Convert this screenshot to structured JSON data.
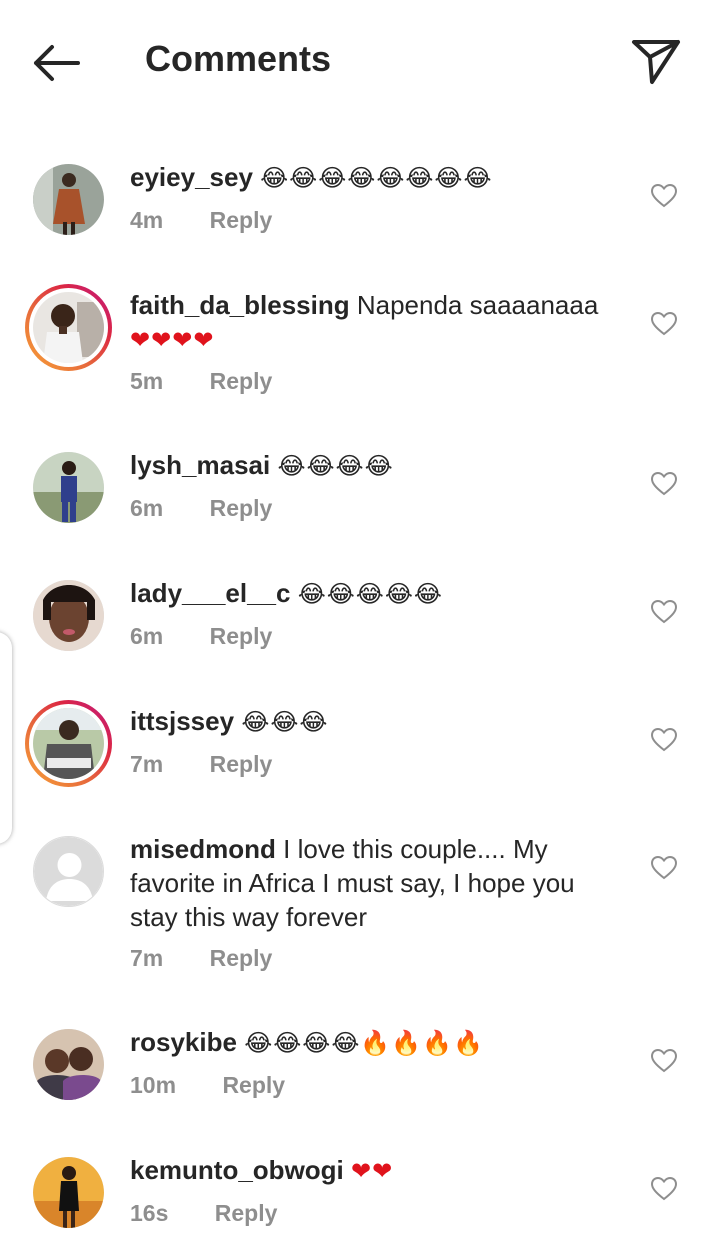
{
  "header": {
    "title": "Comments"
  },
  "colors": {
    "text": "#262626",
    "muted": "#8e8e8e",
    "heart": "#e0131c",
    "story_ring": "#dc2743"
  },
  "reply_label": "Reply",
  "comments": [
    {
      "username": "eyiey_sey",
      "body": "",
      "emoji": "😂😂😂😂😂😂😂😂",
      "time": "4m",
      "avatar": "photo",
      "story": false
    },
    {
      "username": "faith_da_blessing",
      "body": "Napenda saaaanaaa",
      "emoji": "❤❤❤❤",
      "time": "5m",
      "avatar": "photo",
      "story": true
    },
    {
      "username": "lysh_masai",
      "body": "",
      "emoji": "😂😂😂😂",
      "time": "6m",
      "avatar": "photo",
      "story": false
    },
    {
      "username": "lady___el__c",
      "body": "",
      "emoji": "😂😂😂😂😂",
      "time": "6m",
      "avatar": "photo",
      "story": false
    },
    {
      "username": "ittsjssey",
      "body": "",
      "emoji": "😂😂😂",
      "time": "7m",
      "avatar": "photo",
      "story": true
    },
    {
      "username": "misedmond",
      "body": "I love this couple.... My favorite in Africa I must say, I hope you stay this way forever",
      "emoji": "",
      "time": "7m",
      "avatar": "default",
      "story": false
    },
    {
      "username": "rosykibe",
      "body": "",
      "emoji": "😂😂😂😂🔥🔥🔥🔥",
      "time": "10m",
      "avatar": "photo",
      "story": false
    },
    {
      "username": "kemunto_obwogi",
      "body": "",
      "emoji": "❤❤",
      "time": "16s",
      "avatar": "photo",
      "story": false
    }
  ]
}
